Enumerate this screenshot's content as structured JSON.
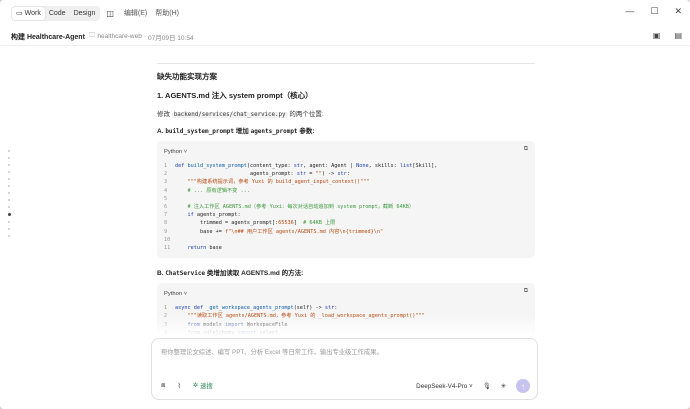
{
  "titlebar": {
    "tabs": [
      {
        "label": "Work",
        "icon": "book-icon"
      },
      {
        "label": "Code"
      },
      {
        "label": "Design"
      }
    ],
    "menu": [
      "编辑(E)",
      "帮助(H)"
    ],
    "window_controls": {
      "minimize": "—",
      "maximize": "☐",
      "close": "✕"
    }
  },
  "header": {
    "title": "构建 Healthcare-Agent",
    "folder": "healthcare-web",
    "timestamp": "07月09日 10:54"
  },
  "doc": {
    "section_title": "缺失功能实现方案",
    "item1_title": "1. AGENTS.md 注入 system prompt（核心）",
    "modify_prefix": "修改",
    "modify_path": "backend/services/chat_service.py",
    "modify_suffix": "的两个位置:",
    "subA_prefix": "A.",
    "subA_code": "build_system_prompt",
    "subA_mid": "增加",
    "subA_code2": "agents_prompt",
    "subA_suffix": "参数:",
    "code1_lang": "Python",
    "subB_prefix": "B.",
    "subB_code": "ChatService",
    "subB_suffix": "类增加读取 AGENTS.md 的方法:",
    "code2_lang": "Python"
  },
  "input": {
    "placeholder": "帮你整理论文综述、编写 PPT、分析 Excel 等日常工作，输出专业级工作成果。",
    "think_label": "速搜",
    "model": "DeepSeek-V4-Pro"
  },
  "colors": {
    "send_button": "#c7c3ef",
    "think": "#2e8b57"
  }
}
